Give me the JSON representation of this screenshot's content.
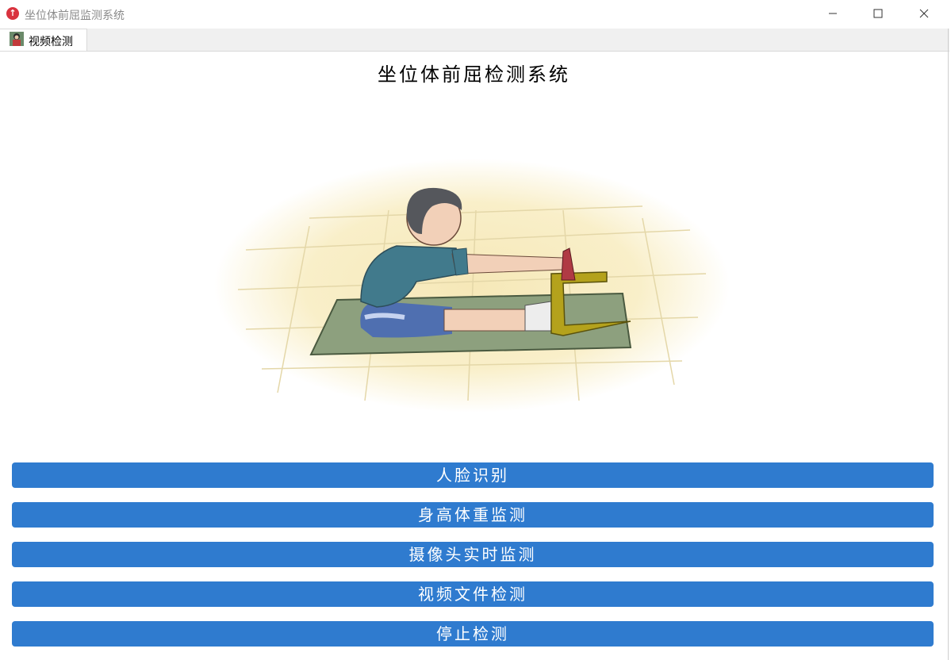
{
  "window": {
    "title": "坐位体前屈监测系统",
    "icon": "app-upload-icon"
  },
  "tabs": [
    {
      "label": "视频检测",
      "icon": "person-thumbnail-icon"
    }
  ],
  "main": {
    "title": "坐位体前屈检测系统",
    "illustration": "boy-sit-and-reach-illustration",
    "buttons": [
      {
        "label": "人脸识别"
      },
      {
        "label": "身高体重监测"
      },
      {
        "label": "摄像头实时监测"
      },
      {
        "label": "视频文件检测"
      },
      {
        "label": "停止检测"
      }
    ]
  },
  "colors": {
    "button_bg": "#2f7bcf",
    "button_text": "#ffffff",
    "app_icon": "#d9333f"
  }
}
